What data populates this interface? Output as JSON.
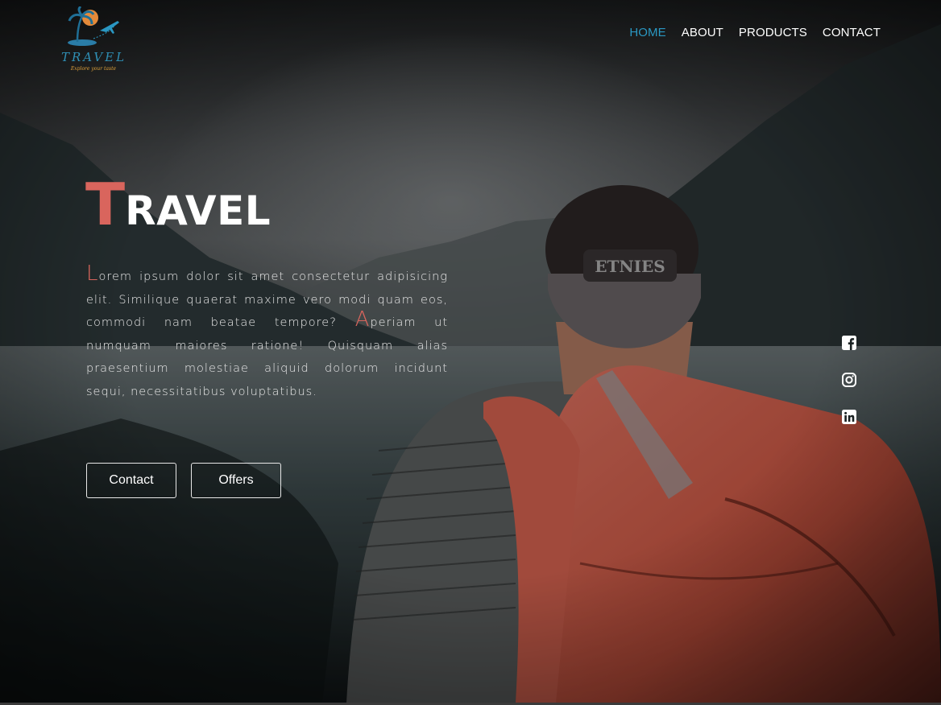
{
  "logo": {
    "word": "TRAVEL",
    "tagline": "Explore your taste"
  },
  "nav": {
    "items": [
      {
        "label": "HOME",
        "active": true
      },
      {
        "label": "ABOUT",
        "active": false
      },
      {
        "label": "PRODUCTS",
        "active": false
      },
      {
        "label": "CONTACT",
        "active": false
      }
    ]
  },
  "hero": {
    "title_first": "T",
    "title_rest": "RAVEL",
    "para1_cap": "L",
    "para1_text": "orem ipsum dolor sit amet consectetur adipisicing elit. Similique quaerat maxime vero modi quam eos, commodi nam beatae tempore?",
    "para2_cap": "A",
    "para2_text": "periam ut numquam maiores ratione! Quisquam alias praesentium molestiae aliquid dolorum incidunt sequi, necessitatibus voluptatibus.",
    "contact_label": "Contact",
    "offers_label": "Offers"
  },
  "social": [
    "facebook-icon",
    "instagram-icon",
    "linkedin-icon"
  ],
  "colors": {
    "accent": "#d9655d",
    "nav_active": "#2a97c2",
    "logo": "#2f8fb5",
    "backpack": "#d8604f"
  }
}
